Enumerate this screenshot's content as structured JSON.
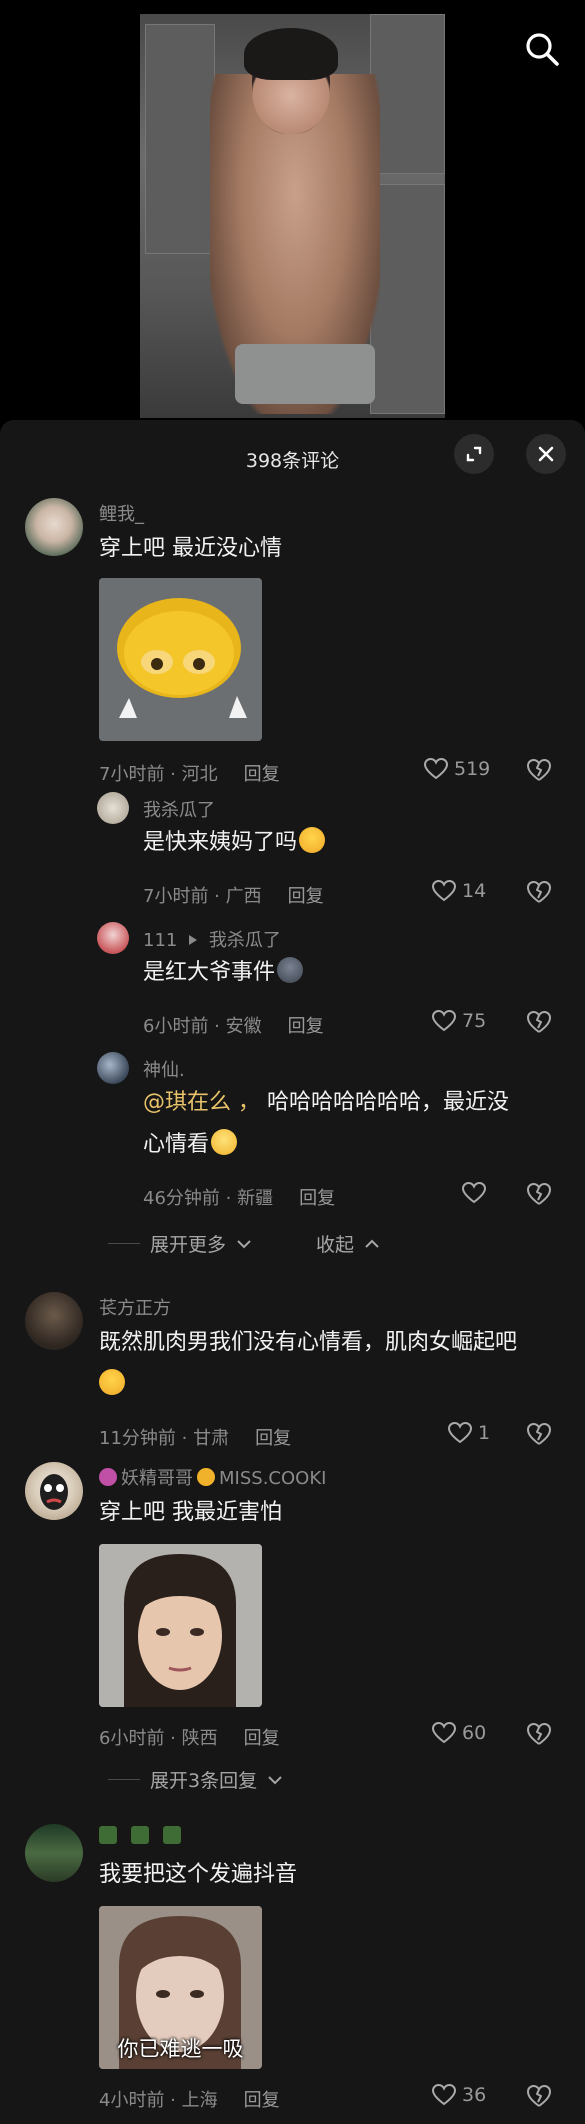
{
  "panel": {
    "title": "398条评论"
  },
  "comments": [
    {
      "name": "鲤我_",
      "text": "穿上吧 最近没心情",
      "meta": "7小时前 · 河北",
      "reply": "回复",
      "likes": "519",
      "attachment": "emoji-sticker"
    },
    {
      "name": "我杀瓜了",
      "text": "是快来姨妈了吗",
      "meta": "7小时前 · 广西",
      "reply": "回复",
      "likes": "14"
    },
    {
      "name": "111",
      "reply_to": "我杀瓜了",
      "text": "是红大爷事件",
      "meta": "6小时前 · 安徽",
      "reply": "回复",
      "likes": "75"
    },
    {
      "name": "神仙.",
      "mention": "@琪在么 ，",
      "text_line1": " 哈哈哈哈哈哈哈，最近没",
      "text_line2": "心情看",
      "meta": "46分钟前 · 新疆",
      "reply": "回复",
      "likes": ""
    },
    {
      "name": "苌方正方",
      "text_line1": "既然肌肉男我们没有心情看，肌肉女崛起吧",
      "meta": "11分钟前 · 甘肃",
      "reply": "回复",
      "likes": "1"
    },
    {
      "name": "妖精哥哥",
      "name_suffix": "MISS.COOKI",
      "text": "穿上吧 我最近害怕",
      "meta": "6小时前 · 陕西",
      "reply": "回复",
      "likes": "60"
    },
    {
      "name": "",
      "text": "我要把这个发遍抖音",
      "caption": "你已难逃一吸",
      "meta": "4小时前 · 上海",
      "reply": "回复",
      "likes": "36"
    }
  ],
  "thread_controls": {
    "expand_more": "展开更多",
    "collapse": "收起",
    "expand_replies": "展开3条回复"
  },
  "icons": [
    "search-icon",
    "expand-icon",
    "close-icon",
    "heart-icon",
    "dislike-icon",
    "chevron-down-icon",
    "chevron-up-icon",
    "play-arrow-icon"
  ],
  "colors": {
    "panel": "#161616",
    "mention": "#e8c36a",
    "text_dim": "#8a8a8a"
  }
}
